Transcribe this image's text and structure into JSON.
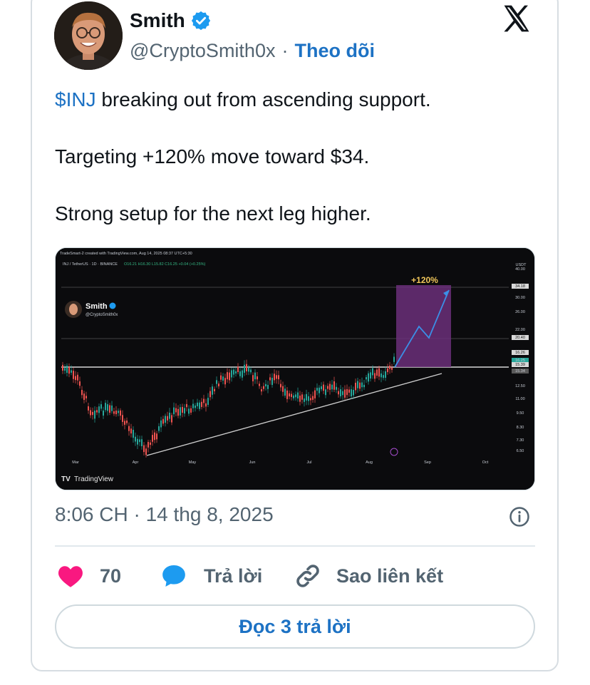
{
  "author": {
    "name": "Smith",
    "handle": "@CryptoSmith0x",
    "separator": "·",
    "follow_label": "Theo dõi"
  },
  "tweet": {
    "cashtag": "$INJ",
    "line1_rest": " breaking out from ascending support.",
    "line2": "Targeting +120% move toward $34.",
    "line3": "Strong setup for the next leg higher."
  },
  "chart_image": {
    "header_text": "TradeSmart-2 created with TradingView.com, Aug 14, 2025 08:37 UTC+5:30",
    "symbol_text": "INJ / TetherUS · 1D · BINANCE",
    "ohlc_text": "O16.21 H16.30 L15.82 C16.25 +0.04 (+0.25%)",
    "watermark_name": "Smith",
    "watermark_handle": "@CryptoSmith0x",
    "target_label": "+120%",
    "currency_label": "USDT",
    "brand_label": "TradingView",
    "x_ticks": [
      "Mar",
      "Apr",
      "May",
      "Jun",
      "Jul",
      "Aug",
      "Sep",
      "Oct"
    ],
    "y_ticks": [
      "40.00",
      "34.18",
      "30.00",
      "26.00",
      "22.00",
      "20.40",
      "16.26",
      "16.25",
      "15.39",
      "15.34",
      "12.50",
      "11.00",
      "9.50",
      "8.30",
      "7.30",
      "6.50"
    ]
  },
  "meta": {
    "timestamp": "8:06 CH · 14 thg 8, 2025"
  },
  "actions": {
    "like_count": "70",
    "reply_label": "Trả lời",
    "copy_link_label": "Sao liên kết"
  },
  "read_replies_label": "Đọc 3 trả lời",
  "colors": {
    "accent": "#1d72c4",
    "like": "#f91880",
    "muted": "#536471",
    "target_zone": "#6b2f7a"
  },
  "icons": [
    "verified-badge-icon",
    "x-logo-icon",
    "info-icon",
    "heart-icon",
    "reply-bubble-icon",
    "link-icon"
  ]
}
